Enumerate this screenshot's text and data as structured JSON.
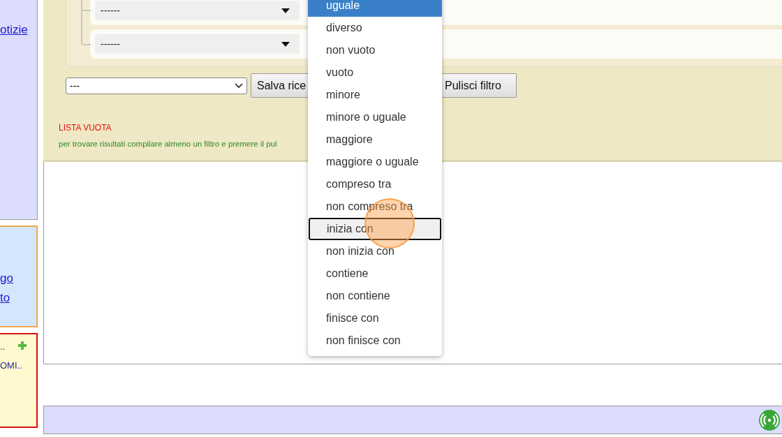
{
  "sidebar": {
    "news_panel": {
      "link": "otizie"
    },
    "links_panel": {
      "links": [
        "go",
        "to"
      ]
    },
    "notes_panel": {
      "items": [
        "..",
        "OMI.."
      ]
    }
  },
  "filter": {
    "conditions": [
      {
        "value": "------"
      },
      {
        "value": "------"
      }
    ],
    "saved_search": {
      "value": "---"
    },
    "buttons": [
      "Salva rice",
      "Pulisci filtro"
    ],
    "status": "LISTA VUOTA",
    "hint": "per trovare risultati compilare almeno un filtro e premere il pul"
  },
  "operator_dropdown": {
    "options": [
      {
        "label": "uguale",
        "selected": true,
        "focused": false
      },
      {
        "label": "diverso",
        "selected": false,
        "focused": false
      },
      {
        "label": "non vuoto",
        "selected": false,
        "focused": false
      },
      {
        "label": "vuoto",
        "selected": false,
        "focused": false
      },
      {
        "label": "minore",
        "selected": false,
        "focused": false
      },
      {
        "label": "minore o uguale",
        "selected": false,
        "focused": false
      },
      {
        "label": "maggiore",
        "selected": false,
        "focused": false
      },
      {
        "label": "maggiore o uguale",
        "selected": false,
        "focused": false
      },
      {
        "label": "compreso tra",
        "selected": false,
        "focused": false
      },
      {
        "label": "non compreso tra",
        "selected": false,
        "focused": false
      },
      {
        "label": "inizia con",
        "selected": false,
        "focused": true
      },
      {
        "label": "non inizia con",
        "selected": false,
        "focused": false
      },
      {
        "label": "contiene",
        "selected": false,
        "focused": false
      },
      {
        "label": "non contiene",
        "selected": false,
        "focused": false
      },
      {
        "label": "finisce con",
        "selected": false,
        "focused": false
      },
      {
        "label": "non finisce con",
        "selected": false,
        "focused": false
      }
    ]
  }
}
